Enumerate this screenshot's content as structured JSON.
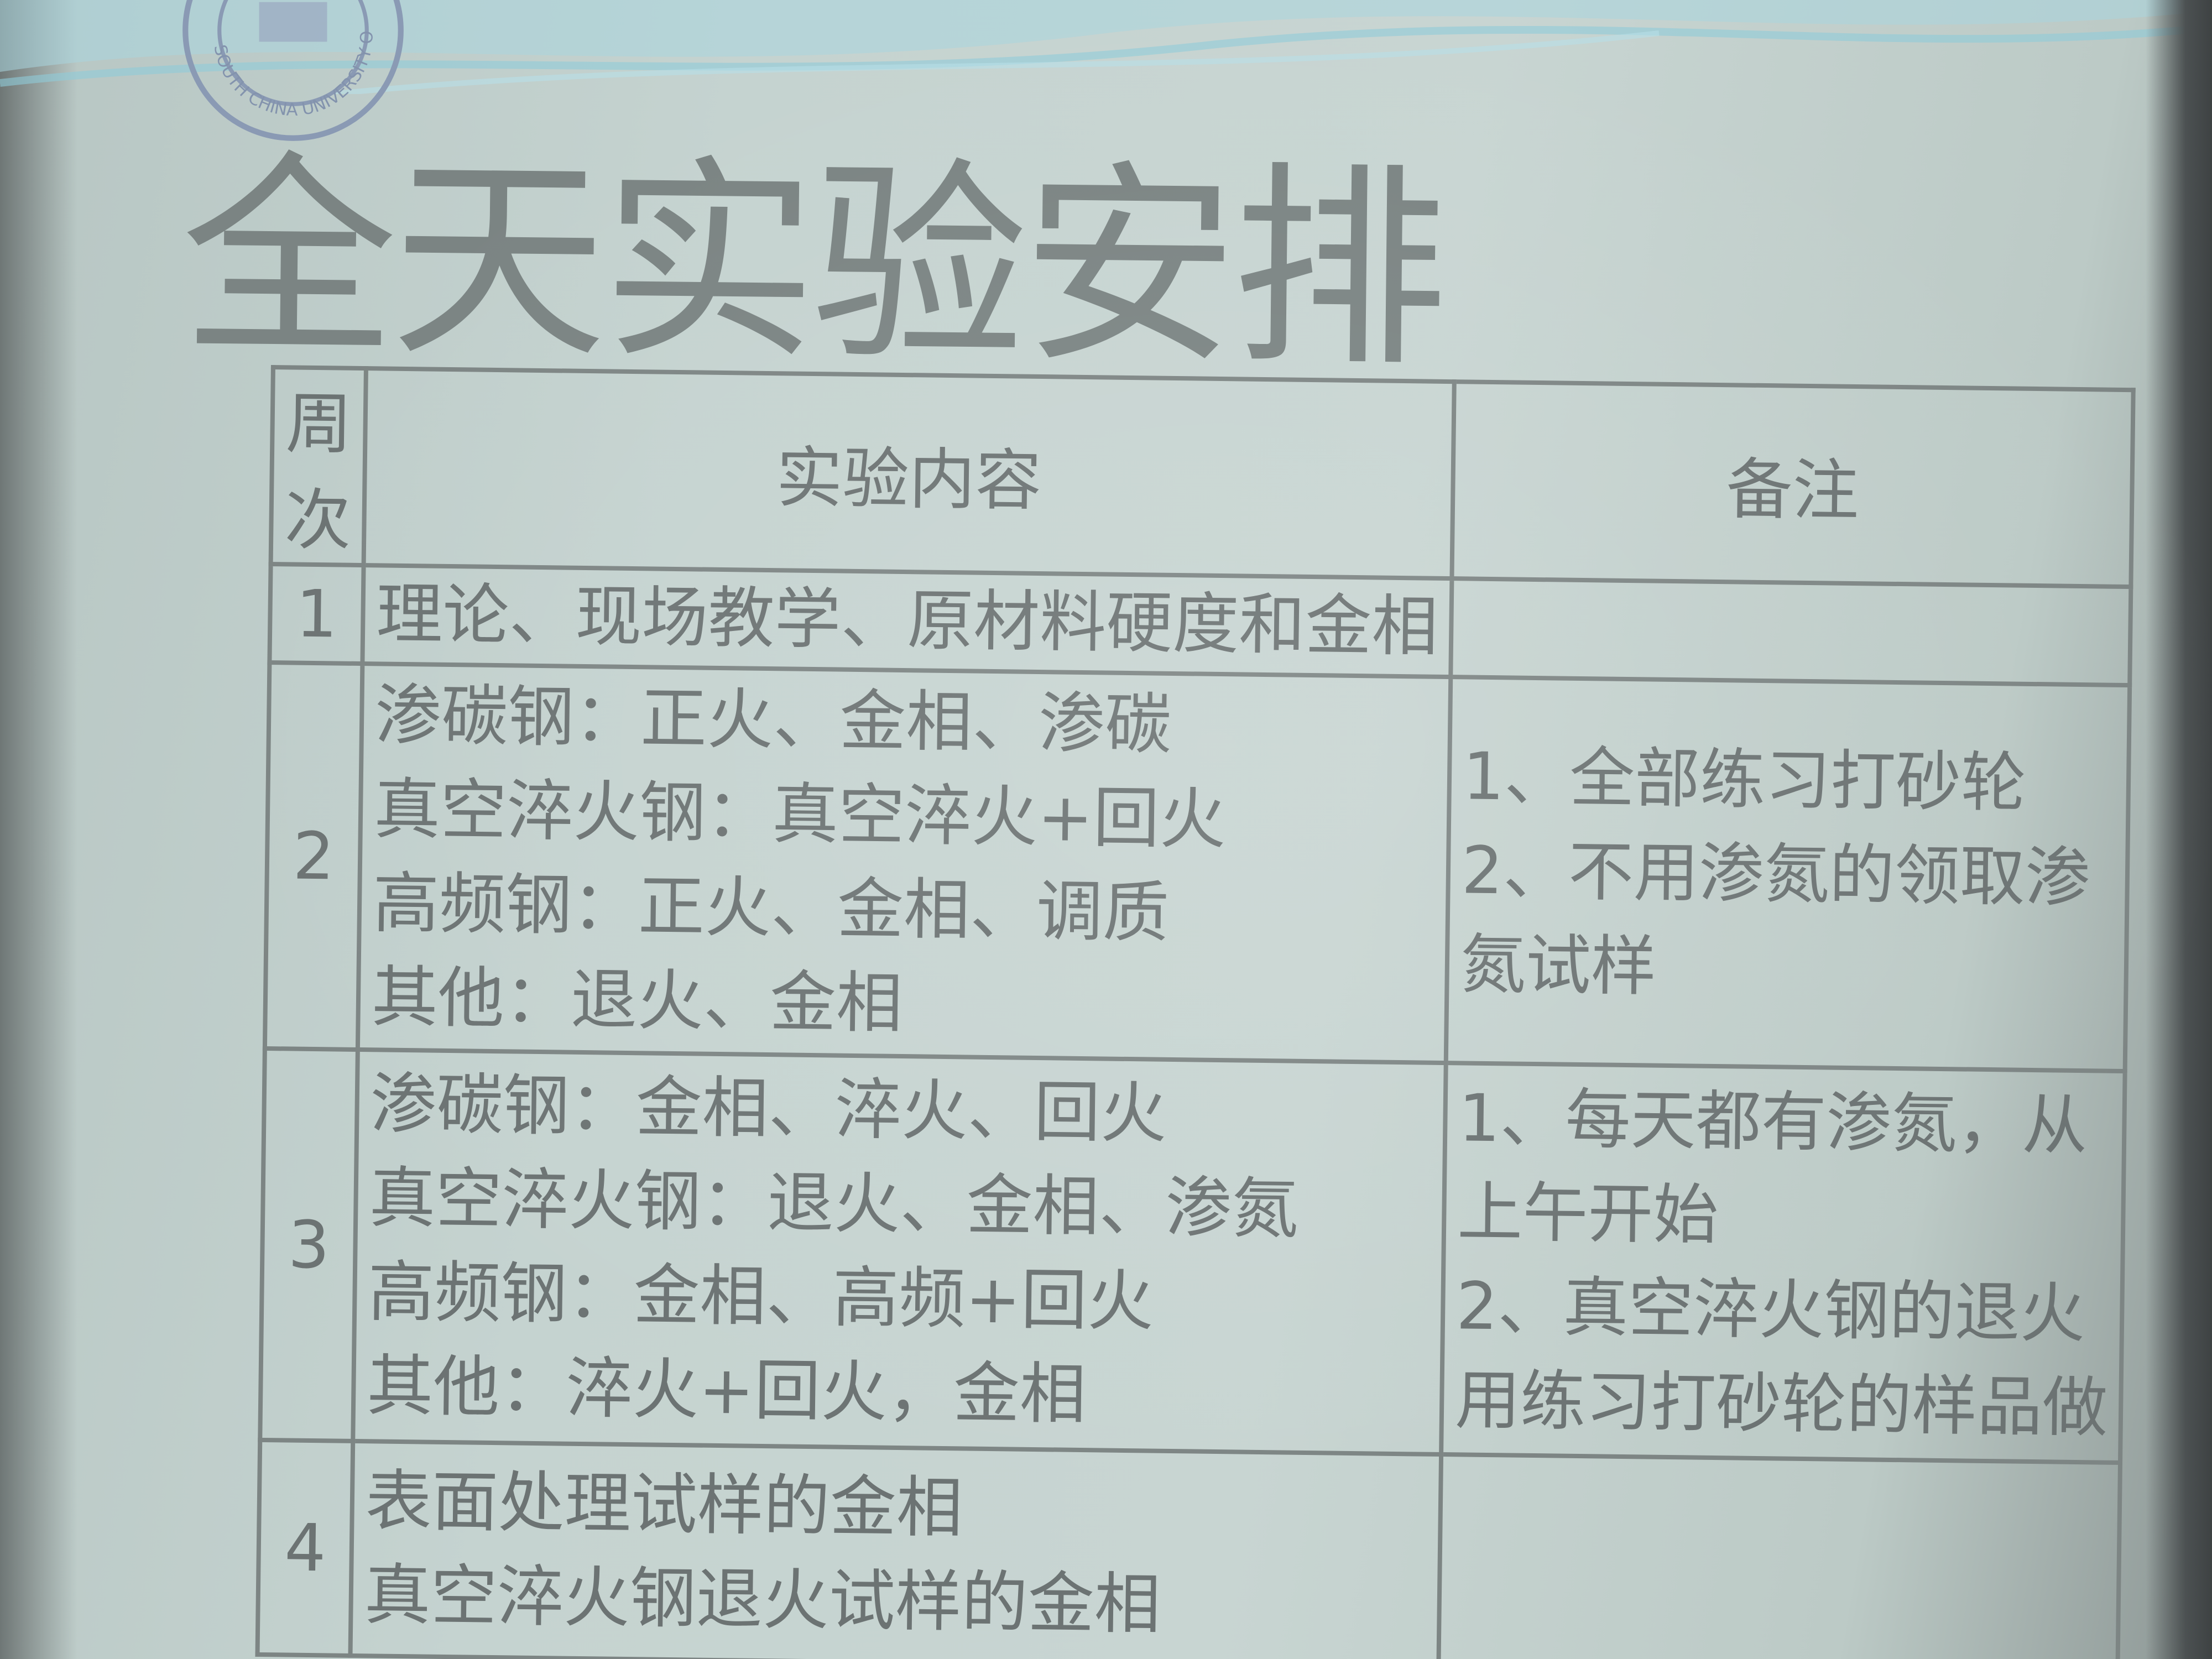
{
  "slide": {
    "title": "全天实验安排",
    "logo_text": "SOUTH CHINA UNIVERSITY OF TECHNOLOGY"
  },
  "table": {
    "headers": {
      "week": "周次",
      "content": "实验内容",
      "note": "备注"
    },
    "rows": [
      {
        "week": "1",
        "content": [
          "理论、现场教学、原材料硬度和金相"
        ],
        "note": []
      },
      {
        "week": "2",
        "content": [
          "渗碳钢：正火、金相、渗碳",
          "真空淬火钢：真空淬火+回火",
          "高频钢：正火、金相、调质",
          "其他：退火、金相"
        ],
        "note": [
          "1、全部练习打砂轮",
          "2、不用渗氮的领取渗",
          "氮试样"
        ]
      },
      {
        "week": "3",
        "content": [
          "渗碳钢：金相、淬火、回火",
          "真空淬火钢：退火、金相、渗氮",
          "高频钢：金相、高频+回火",
          "其他：淬火+回火，金相"
        ],
        "note": [
          "1、每天都有渗氮，从",
          "上午开始",
          "2、真空淬火钢的退火",
          "用练习打砂轮的样品做"
        ]
      },
      {
        "week": "4",
        "content": [
          "表面处理试样的金相",
          "真空淬火钢退火试样的金相"
        ],
        "note": []
      }
    ]
  },
  "colors": {
    "screen": "#c5d3d0",
    "text": "#6c7373",
    "title": "#7b8483",
    "swoosh": "#9fd3e0"
  }
}
